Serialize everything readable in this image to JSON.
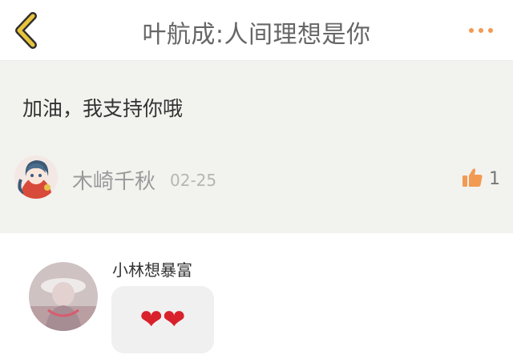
{
  "header": {
    "title": "叶航成:人间理想是你",
    "accent_color": "#f29a52",
    "back_icon": "chevron-left-icon",
    "more_icon": "more-dots-icon"
  },
  "comment": {
    "text": "加油，我支持你哦",
    "author": "木崎千秋",
    "date": "02-25",
    "like_count": "1",
    "like_icon": "thumbs-up-icon"
  },
  "reply": {
    "author": "小林想暴富",
    "text": "❤❤"
  }
}
